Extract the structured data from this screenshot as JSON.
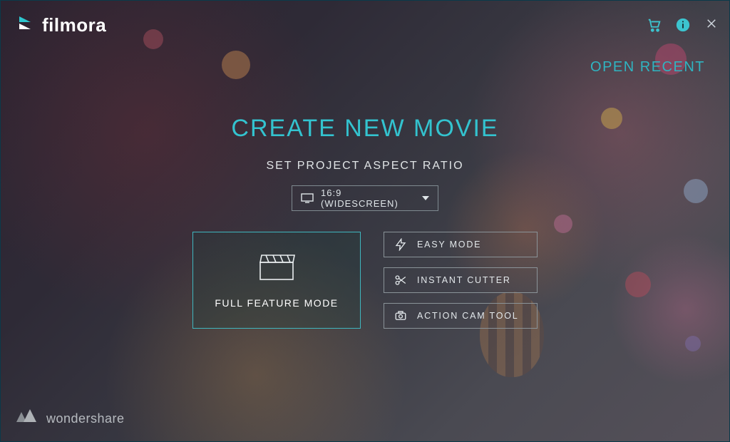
{
  "brand": {
    "name": "filmora"
  },
  "topbar": {
    "open_recent": "OPEN RECENT"
  },
  "main": {
    "title": "CREATE NEW MOVIE",
    "subtitle": "SET PROJECT ASPECT RATIO",
    "aspect_ratio_selected": "16:9  (WIDESCREEN)"
  },
  "modes": {
    "full": "FULL FEATURE MODE",
    "easy": "EASY MODE",
    "instant_cutter": "INSTANT CUTTER",
    "action_cam": "ACTION CAM TOOL"
  },
  "footer": {
    "company": "wondershare"
  },
  "colors": {
    "accent": "#33c3cf"
  }
}
